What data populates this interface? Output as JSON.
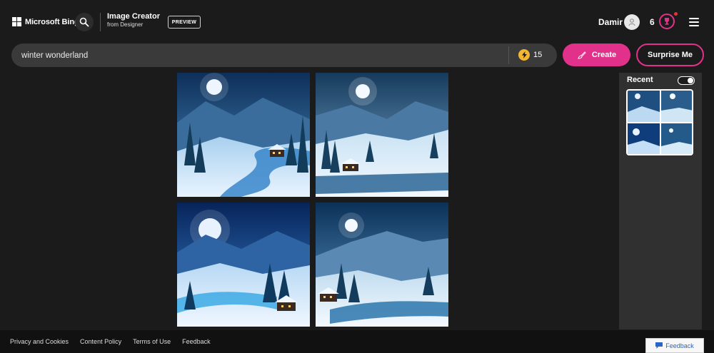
{
  "header": {
    "brand": "Microsoft Bing",
    "title": "Image Creator",
    "subtitle": "from Designer",
    "badge": "PREVIEW",
    "user_name": "Damir",
    "rewards_count": "6"
  },
  "search": {
    "value": "winter wonderland",
    "boosts": "15"
  },
  "actions": {
    "create_label": "Create",
    "surprise_label": "Surprise Me"
  },
  "recent": {
    "label": "Recent",
    "toggle_on": true
  },
  "footer": {
    "links": [
      "Privacy and Cookies",
      "Content Policy",
      "Terms of Use",
      "Feedback"
    ],
    "feedback_button": "Feedback"
  },
  "colors": {
    "accent": "#e2318a",
    "background": "#1b1b1b",
    "boost": "#f2b632"
  }
}
